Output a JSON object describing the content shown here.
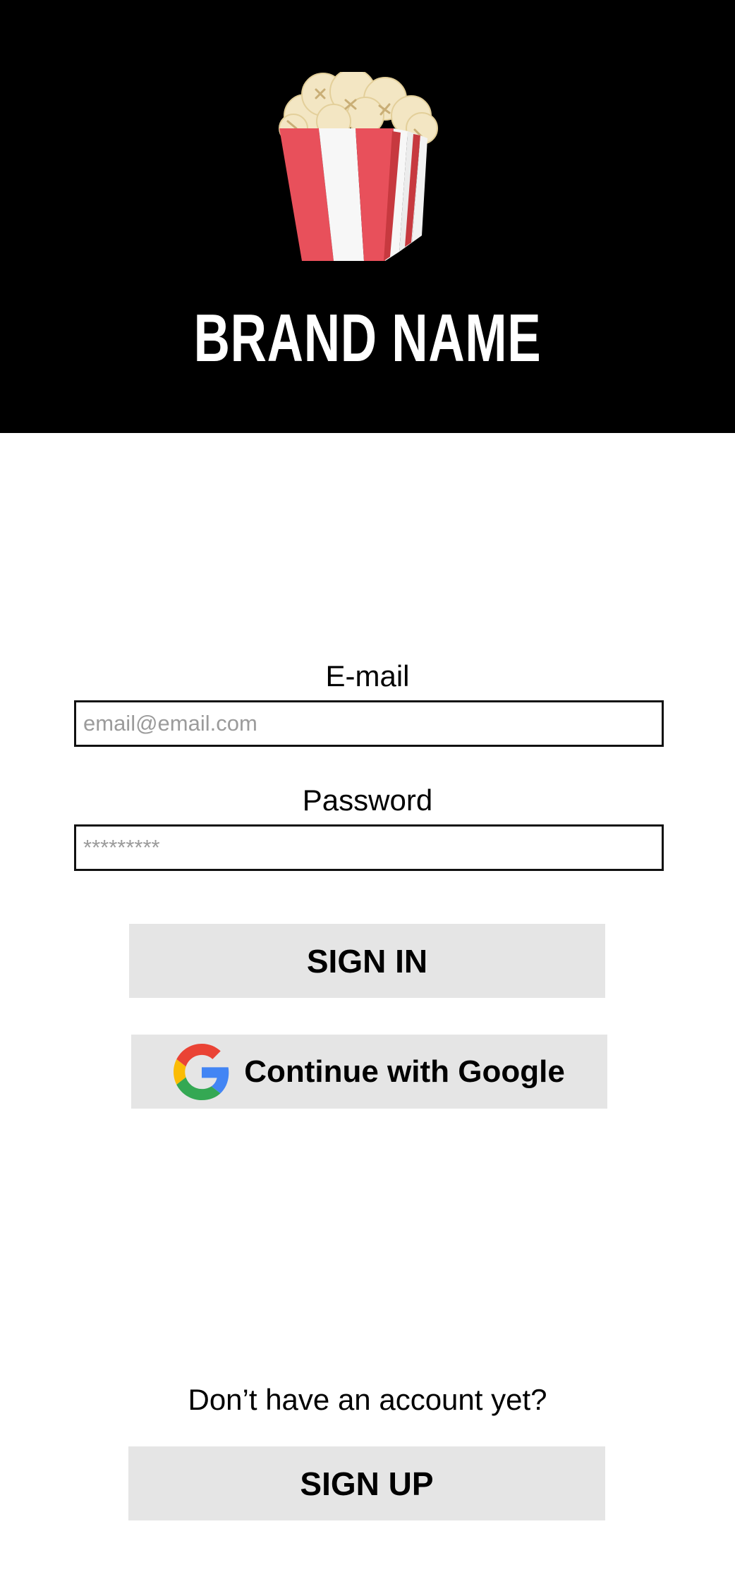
{
  "brand": {
    "name": "BRAND NAME",
    "logo_icon": "popcorn-bucket-icon"
  },
  "form": {
    "email_label": "E-mail",
    "email_placeholder": "email@email.com",
    "password_label": "Password",
    "password_placeholder": "*********",
    "sign_in_label": "SIGN IN",
    "google_label": "Continue with Google",
    "google_icon": "google-g-icon"
  },
  "signup": {
    "prompt": "Don’t have an account yet?",
    "button_label": "SIGN UP"
  },
  "colors": {
    "header_bg": "#000000",
    "button_bg": "#e5e5e5",
    "stripe_red": "#e8505b",
    "stripe_dark_red": "#c7393f"
  }
}
